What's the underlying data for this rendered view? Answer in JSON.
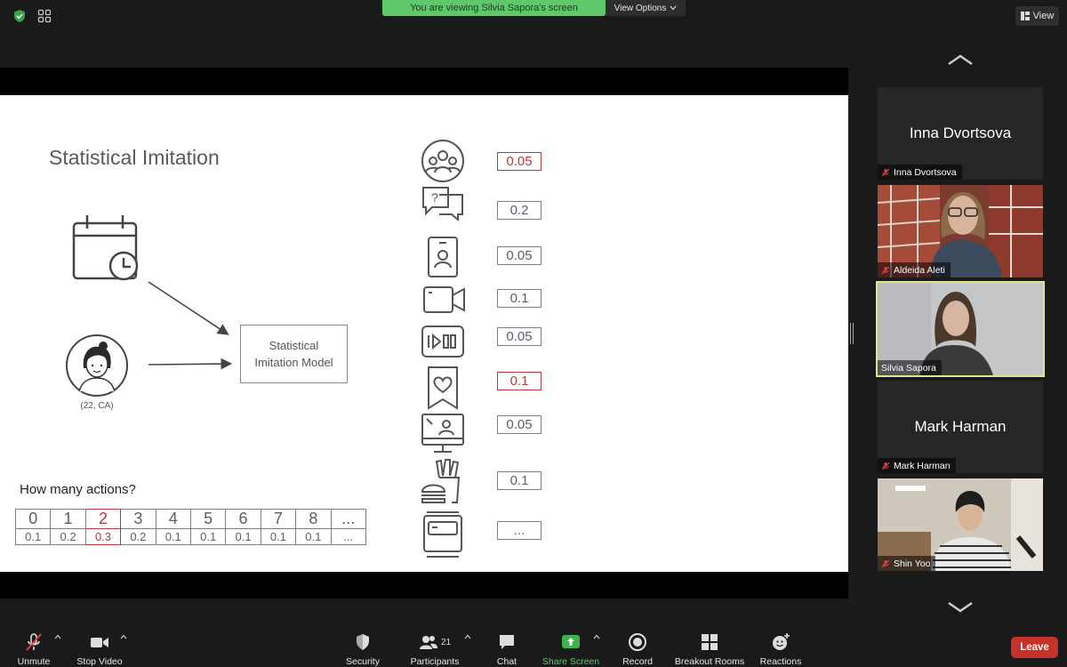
{
  "top": {
    "banner": "You are viewing Silvia Sapora's screen",
    "view_options": "View Options",
    "view_button": "View"
  },
  "slide": {
    "title": "Statistical Imitation",
    "model_box": [
      "Statistical",
      "Imitation Model"
    ],
    "avatar_caption": "(22, CA)",
    "actions_question": "How many actions?",
    "action_counts": [
      "0",
      "1",
      "2",
      "3",
      "4",
      "5",
      "6",
      "7",
      "8",
      "..."
    ],
    "action_probs": [
      "0.1",
      "0.2",
      "0.3",
      "0.2",
      "0.1",
      "0.1",
      "0.1",
      "0.1",
      "0.1",
      "..."
    ],
    "highlight_index": 2,
    "feature_values": [
      "0.05",
      "0.2",
      "0.05",
      "0.1",
      "0.05",
      "0.1",
      "0.05",
      "0.1",
      "..."
    ],
    "feature_highlight": [
      true,
      false,
      false,
      false,
      false,
      true,
      false,
      false,
      false
    ],
    "feature_icons": [
      "group-icon",
      "question-chat-icon",
      "profile-card-icon",
      "video-camera-icon",
      "video-player-icon",
      "heart-bookmark-icon",
      "computer-profile-icon",
      "fast-food-icon",
      "tv-icon"
    ],
    "highlight_color": "#b83a3a"
  },
  "participants": [
    {
      "name": "Inna Dvortsova",
      "video": false,
      "muted": true
    },
    {
      "name": "Aldeida Aleti",
      "video": true,
      "muted": true
    },
    {
      "name": "Silvia Sapora",
      "video": true,
      "muted": false,
      "active": true
    },
    {
      "name": "Mark Harman",
      "video": false,
      "muted": true
    },
    {
      "name": "Shin Yoo",
      "video": true,
      "muted": true
    }
  ],
  "toolbar": {
    "unmute": "Unmute",
    "stop_video": "Stop Video",
    "security": "Security",
    "participants": "Participants",
    "participants_count": "21",
    "chat": "Chat",
    "share_screen": "Share Screen",
    "record": "Record",
    "breakout_rooms": "Breakout Rooms",
    "reactions": "Reactions",
    "leave": "Leave"
  },
  "colors": {
    "banner_green": "#5dc96b",
    "leave_red": "#c6312a",
    "active_speaker_border": "#e3e58a"
  }
}
